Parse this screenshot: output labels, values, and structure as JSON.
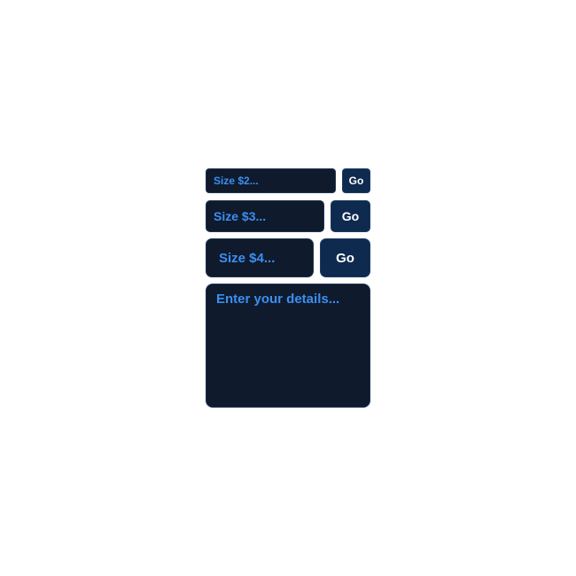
{
  "form": {
    "rows": [
      {
        "placeholder": "Size $2...",
        "button_label": "Go"
      },
      {
        "placeholder": "Size $3...",
        "button_label": "Go"
      },
      {
        "placeholder": "Size $4...",
        "button_label": "Go"
      }
    ],
    "textarea_placeholder": "Enter your details..."
  },
  "colors": {
    "field_background": "#0f1a2d",
    "button_background": "#0e2a4f",
    "placeholder_text": "#3b8ff0",
    "button_text": "#ffffff",
    "page_background": "#ffffff"
  }
}
